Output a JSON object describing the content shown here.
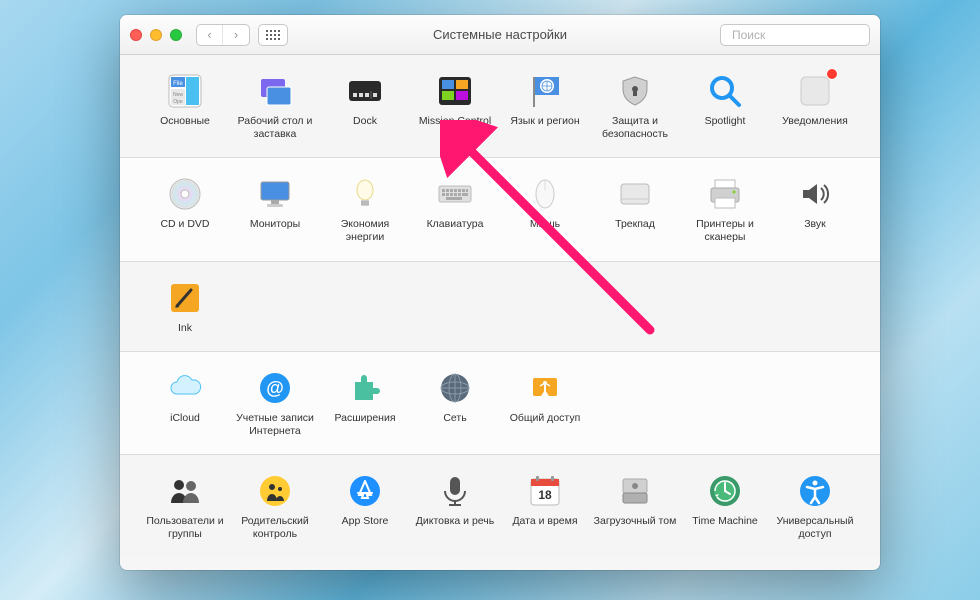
{
  "window": {
    "title": "Системные настройки",
    "search_placeholder": "Поиск"
  },
  "rows": [
    {
      "items": [
        {
          "id": "general",
          "label": "Основные"
        },
        {
          "id": "desktop",
          "label": "Рабочий стол и заставка"
        },
        {
          "id": "dock",
          "label": "Dock"
        },
        {
          "id": "mission",
          "label": "Mission Control"
        },
        {
          "id": "language",
          "label": "Язык и регион"
        },
        {
          "id": "security",
          "label": "Защита и безопасность"
        },
        {
          "id": "spotlight",
          "label": "Spotlight"
        },
        {
          "id": "notifications",
          "label": "Уведомления",
          "badge": true
        }
      ]
    },
    {
      "items": [
        {
          "id": "cddvd",
          "label": "CD и DVD"
        },
        {
          "id": "displays",
          "label": "Мониторы"
        },
        {
          "id": "energy",
          "label": "Экономия энергии"
        },
        {
          "id": "keyboard",
          "label": "Клавиатура"
        },
        {
          "id": "mouse",
          "label": "Мышь"
        },
        {
          "id": "trackpad",
          "label": "Трекпад"
        },
        {
          "id": "printers",
          "label": "Принтеры и сканеры"
        },
        {
          "id": "sound",
          "label": "Звук"
        }
      ]
    },
    {
      "items": [
        {
          "id": "ink",
          "label": "Ink"
        }
      ]
    },
    {
      "items": [
        {
          "id": "icloud",
          "label": "iCloud"
        },
        {
          "id": "accounts",
          "label": "Учетные записи Интернета"
        },
        {
          "id": "extensions",
          "label": "Расширения"
        },
        {
          "id": "network",
          "label": "Сеть"
        },
        {
          "id": "sharing",
          "label": "Общий доступ"
        }
      ]
    },
    {
      "items": [
        {
          "id": "users",
          "label": "Пользователи и группы"
        },
        {
          "id": "parental",
          "label": "Родительский контроль"
        },
        {
          "id": "appstore",
          "label": "App Store"
        },
        {
          "id": "dictation",
          "label": "Диктовка и речь"
        },
        {
          "id": "datetime",
          "label": "Дата и время"
        },
        {
          "id": "startup",
          "label": "Загрузочный том"
        },
        {
          "id": "timemachine",
          "label": "Time Machine"
        },
        {
          "id": "accessibility",
          "label": "Универсальный доступ"
        }
      ]
    }
  ],
  "annotation": {
    "arrow_target": "mission"
  }
}
